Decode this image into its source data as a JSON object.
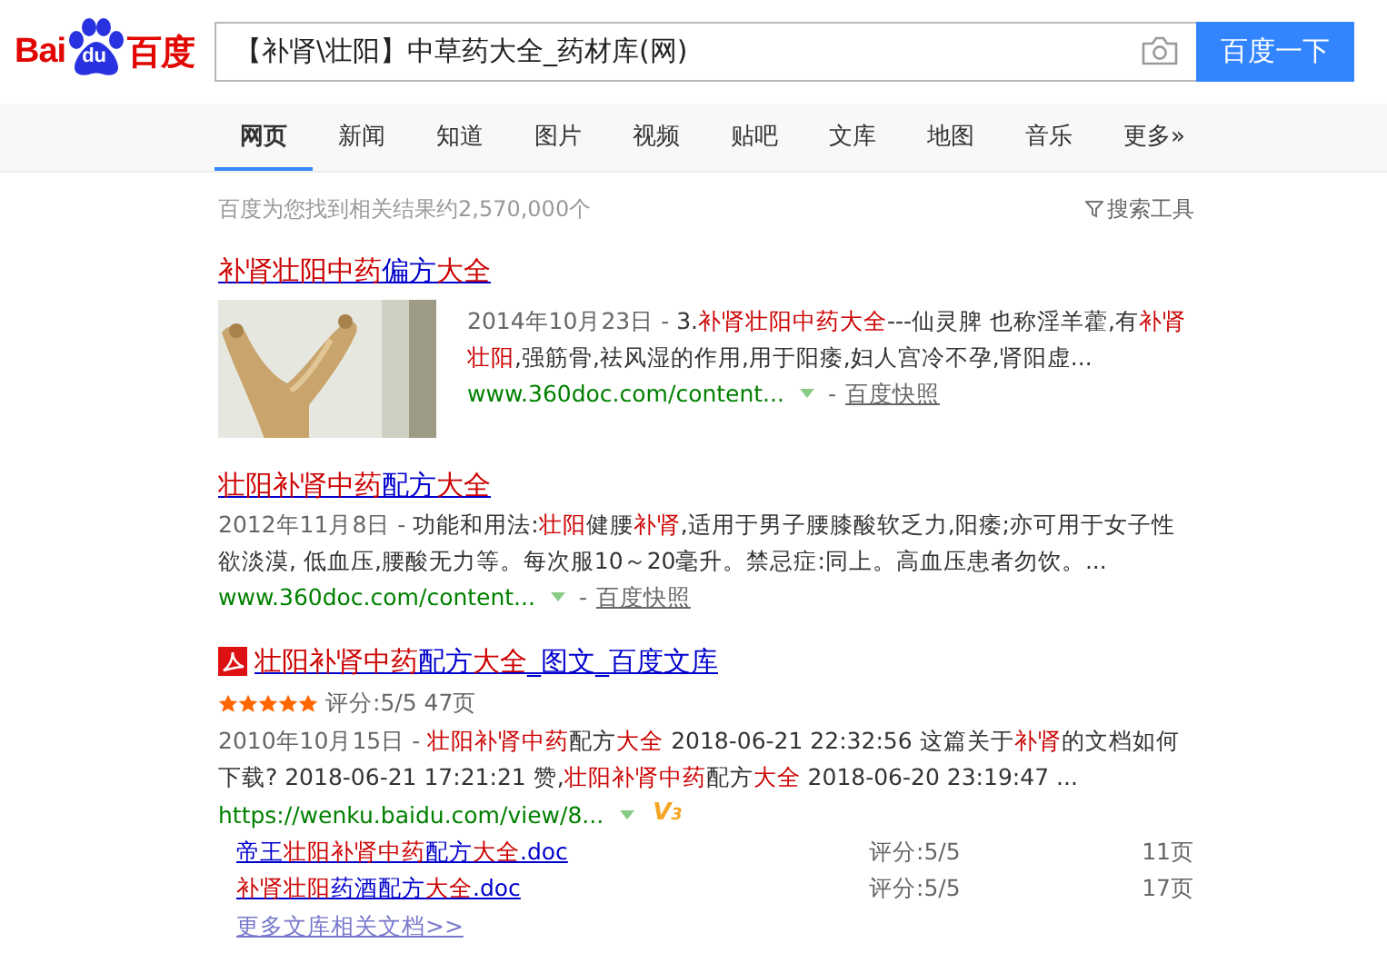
{
  "logo": {
    "left": "Bai",
    "paw": "du",
    "right": "百度"
  },
  "search": {
    "value": "【补肾\\壮阳】中草药大全_药材库(网)",
    "button": "百度一下"
  },
  "tabs": [
    {
      "label": "网页",
      "selected": true
    },
    {
      "label": "新闻",
      "selected": false
    },
    {
      "label": "知道",
      "selected": false
    },
    {
      "label": "图片",
      "selected": false
    },
    {
      "label": "视频",
      "selected": false
    },
    {
      "label": "贴吧",
      "selected": false
    },
    {
      "label": "文库",
      "selected": false
    },
    {
      "label": "地图",
      "selected": false
    },
    {
      "label": "音乐",
      "selected": false
    },
    {
      "label": "更多»",
      "selected": false
    }
  ],
  "result_count": "百度为您找到相关结果约2,570,000个",
  "search_tools": "搜索工具",
  "results": [
    {
      "title": [
        {
          "text": "补肾壮阳中药",
          "hl": true
        },
        {
          "text": "偏方",
          "hl": false
        },
        {
          "text": "大全",
          "hl": true
        }
      ],
      "date": "2014年10月23日 - ",
      "abstract": [
        {
          "text": "3.",
          "hl": false
        },
        {
          "text": "补肾壮阳中药大全",
          "hl": true
        },
        {
          "text": "---仙灵脾 也称淫羊藿,有",
          "hl": false
        },
        {
          "text": "补肾壮阳",
          "hl": true
        },
        {
          "text": ",强筋骨,祛风湿的作用,用于阳痿,妇人宫冷不孕,肾阳虚...",
          "hl": false
        }
      ],
      "url": "www.360doc.com/content...",
      "separator": "-",
      "snapshot": "百度快照"
    },
    {
      "kind": "text",
      "title": [
        {
          "text": "壮阳补肾中药",
          "hl": true
        },
        {
          "text": "配方",
          "hl": false
        },
        {
          "text": "大全",
          "hl": true
        }
      ],
      "date": "2012年11月8日 - ",
      "abstract": [
        {
          "text": "功能和用法:",
          "hl": false
        },
        {
          "text": "壮阳",
          "hl": true
        },
        {
          "text": "健腰",
          "hl": false
        },
        {
          "text": "补肾",
          "hl": true
        },
        {
          "text": ",适用于男子腰膝酸软乏力,阳痿;亦可用于女子性欲淡漠, 低血压,腰酸无力等。每次服10～20毫升。禁忌症:同上。高血压患者勿饮。...",
          "hl": false
        }
      ],
      "url": "www.360doc.com/content...",
      "separator": "-",
      "snapshot": "百度快照"
    },
    {
      "kind": "doc",
      "title": [
        {
          "text": "壮阳补肾中药",
          "hl": true
        },
        {
          "text": "配方",
          "hl": false
        },
        {
          "text": "大全",
          "hl": true
        },
        {
          "text": "_图文_百度文库",
          "hl": false
        }
      ],
      "stars": 5,
      "rating": "评分:5/5 47页",
      "date": "2010年10月15日 - ",
      "abstract": [
        {
          "text": "壮阳补肾中药",
          "hl": true
        },
        {
          "text": "配方",
          "hl": false
        },
        {
          "text": "大全",
          "hl": true
        },
        {
          "text": " 2018-06-21 22:32:56 这篇关于",
          "hl": false
        },
        {
          "text": "补肾",
          "hl": true
        },
        {
          "text": "的文档如何下载? 2018-06-21 17:21:21 赞,",
          "hl": false
        },
        {
          "text": "壮阳补肾中药",
          "hl": true
        },
        {
          "text": "配方",
          "hl": false
        },
        {
          "text": "大全",
          "hl": true
        },
        {
          "text": " 2018-06-20 23:19:47 ...",
          "hl": false
        }
      ],
      "url": "https://wenku.baidu.com/view/8...",
      "badge": "V3",
      "docs": [
        {
          "title": [
            {
              "text": "帝王",
              "hl": false
            },
            {
              "text": "壮阳补肾中药",
              "hl": true
            },
            {
              "text": "配方",
              "hl": false
            },
            {
              "text": "大全",
              "hl": true
            },
            {
              "text": ".doc",
              "hl": false
            }
          ],
          "rating": "评分:5/5",
          "pages": "11页"
        },
        {
          "title": [
            {
              "text": "补肾壮阳",
              "hl": true
            },
            {
              "text": "药酒配方",
              "hl": false
            },
            {
              "text": "大全",
              "hl": true
            },
            {
              "text": ".doc",
              "hl": false
            }
          ],
          "rating": "评分:5/5",
          "pages": "17页"
        }
      ],
      "more": "更多文库相关文档>>"
    }
  ]
}
